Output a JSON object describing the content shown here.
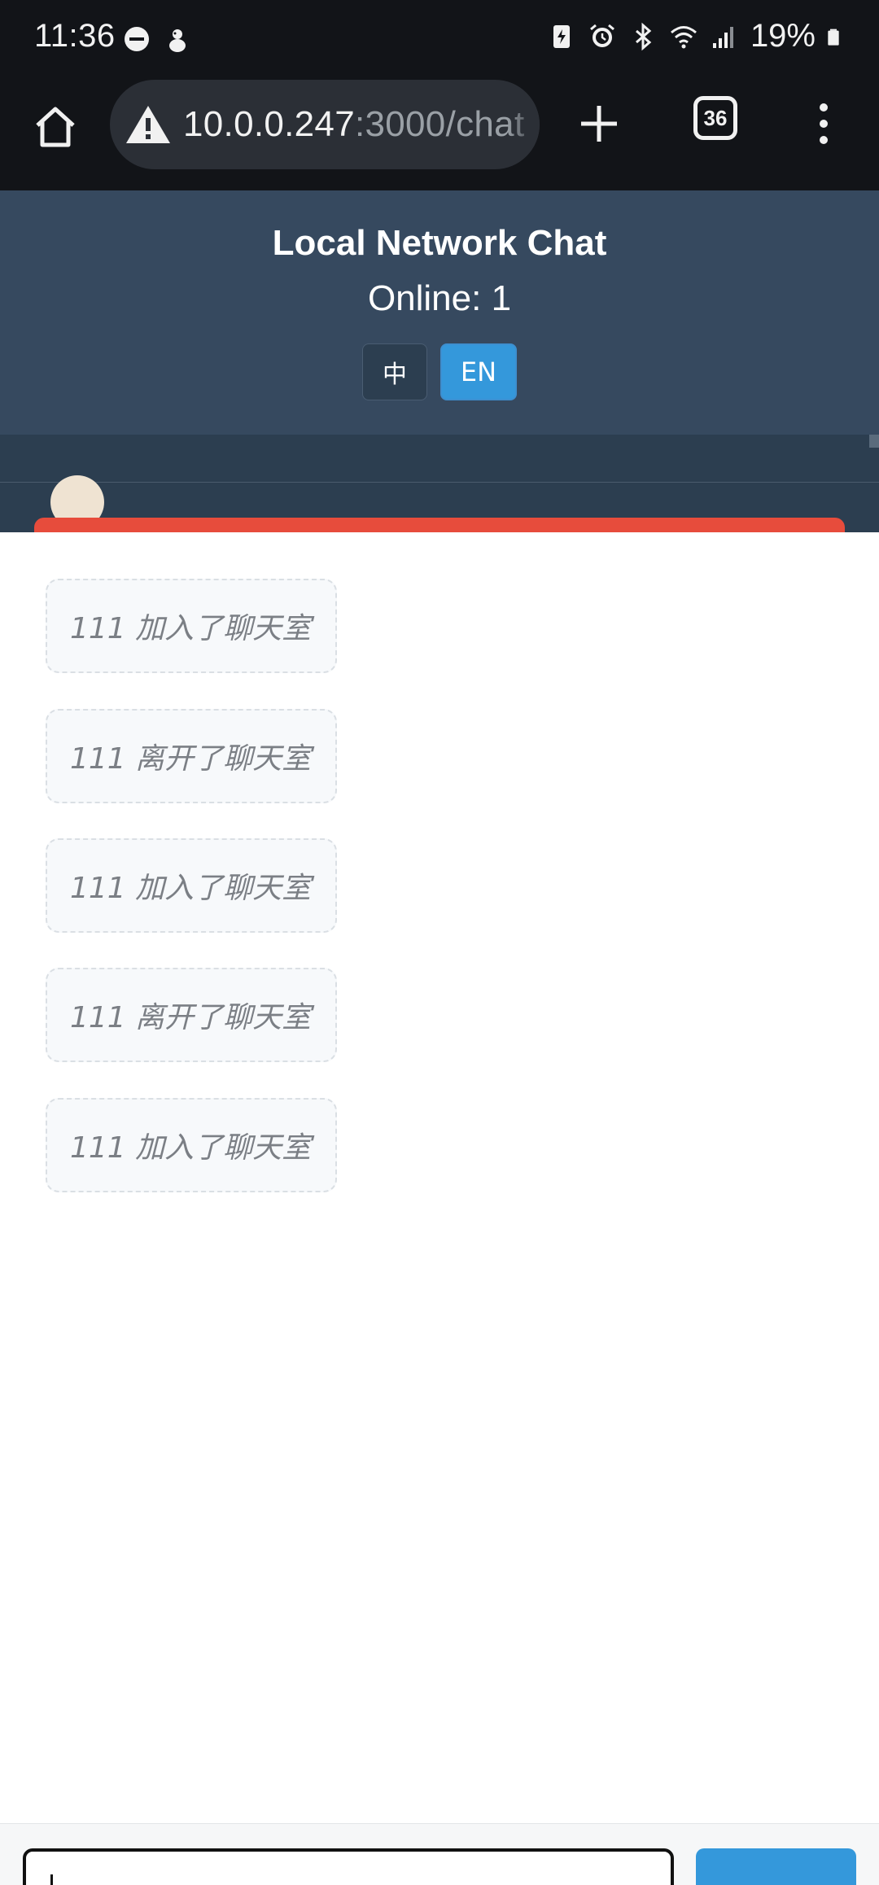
{
  "status_bar": {
    "time": "11:36",
    "battery_percent": "19%",
    "left_icons": [
      "do-not-disturb-icon",
      "notification-app-icon"
    ],
    "right_icons": [
      "battery-saver-icon",
      "alarm-icon",
      "bluetooth-icon",
      "wifi-icon",
      "cell-signal-icon",
      "battery-icon"
    ]
  },
  "browser": {
    "url_host": "10.0.0.247",
    "url_rest": ":3000/chat",
    "tab_count": "36",
    "security": "not-secure-warning"
  },
  "header": {
    "title": "Local Network Chat",
    "online_label": "Online: ",
    "online_count": "1",
    "lang_zh": "中",
    "lang_en": "EN",
    "active_lang": "EN"
  },
  "messages": [
    {
      "text": "111 加入了聊天室"
    },
    {
      "text": "111 离开了聊天室"
    },
    {
      "text": "111 加入了聊天室"
    },
    {
      "text": "111 离开了聊天室"
    },
    {
      "text": "111 加入了聊天室"
    }
  ],
  "input": {
    "value": ""
  },
  "colors": {
    "header_bg": "#36495f",
    "users_bg": "#2c3e50",
    "accent": "#3498db",
    "notice": "#e74c3c",
    "browser_bg": "#121418"
  }
}
